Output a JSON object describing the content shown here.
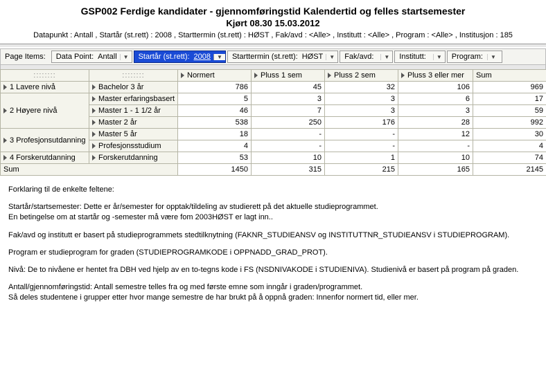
{
  "header": {
    "title": "GSP002 Ferdige kandidater - gjennomføringstid Kalendertid og felles startsemester",
    "run": "Kjørt 08.30 15.03.2012",
    "datapoint": "Datapunkt : Antall , Startår (st.rett) : 2008 , Starttermin (st.rett) : HØST , Fak/avd : <Alle> , Institutt : <Alle> , Program : <Alle> , Institusjon : 185"
  },
  "pageItems": {
    "label": "Page Items:",
    "pills": [
      {
        "label": "Data Point:",
        "value": "Antall",
        "selected": false
      },
      {
        "label": "Startår (st.rett):",
        "value": "2008",
        "selected": true
      },
      {
        "label": "Starttermin (st.rett):",
        "value": "HØST",
        "selected": false
      },
      {
        "label": "Fak/avd:",
        "value": "<Alle>",
        "selected": false
      },
      {
        "label": "Institutt:",
        "value": "<Alle>",
        "selected": false
      },
      {
        "label": "Program:",
        "value": "<A",
        "selected": false
      }
    ]
  },
  "table": {
    "columns": [
      "Normert",
      "Pluss 1 sem",
      "Pluss 2 sem",
      "Pluss 3 eller mer",
      "Sum"
    ],
    "groups": [
      {
        "label": "1 Lavere nivå",
        "rows": [
          {
            "label": "Bachelor 3 år",
            "cells": [
              "786",
              "45",
              "32",
              "106",
              "969"
            ]
          }
        ]
      },
      {
        "label": "2 Høyere nivå",
        "rows": [
          {
            "label": "Master erfaringsbasert",
            "cells": [
              "5",
              "3",
              "3",
              "6",
              "17"
            ]
          },
          {
            "label": "Master 1 - 1 1/2 år",
            "cells": [
              "46",
              "7",
              "3",
              "3",
              "59"
            ]
          },
          {
            "label": "Master 2 år",
            "cells": [
              "538",
              "250",
              "176",
              "28",
              "992"
            ]
          }
        ]
      },
      {
        "label": "3 Profesjonsutdanning",
        "rows": [
          {
            "label": "Master 5 år",
            "cells": [
              "18",
              "-",
              "-",
              "12",
              "30"
            ]
          },
          {
            "label": "Profesjonsstudium",
            "cells": [
              "4",
              "-",
              "-",
              "-",
              "4"
            ]
          }
        ]
      },
      {
        "label": "4 Forskerutdanning",
        "rows": [
          {
            "label": "Forskerutdanning",
            "cells": [
              "53",
              "10",
              "1",
              "10",
              "74"
            ]
          }
        ]
      }
    ],
    "sumLabel": "Sum",
    "sumRow": [
      "1450",
      "315",
      "215",
      "165",
      "2145"
    ]
  },
  "explain": {
    "intro": "Forklaring til de enkelte feltene:",
    "p1a": "Startår/startsemester: Dette er år/semester for opptak/tildeling av studierett på det aktuelle studieprogrammet.",
    "p1b": "En betingelse om at startår og -semester må være fom 2003HØST er lagt inn..",
    "p2": "Fak/avd og institutt er basert på studieprogrammets stedtilknytning (FAKNR_STUDIEANSV og INSTITUTTNR_STUDIEANSV i STUDIEPROGRAM).",
    "p3": "Program er studieprogram for graden (STUDIEPROGRAMKODE i OPPNADD_GRAD_PROT).",
    "p4": "Nivå: De to nivåene er hentet fra DBH ved hjelp av en to-tegns kode i FS (NSDNIVAKODE i STUDIENIVA). Studienivå er basert på program på graden.",
    "p5a": "Antall/gjennomføringstid: Antall semestre telles fra og med første emne som inngår i graden/programmet.",
    "p5b": "Så deles studentene i grupper etter hvor mange semestre de har brukt på å oppnå graden: Innenfor normert tid, eller mer."
  },
  "chart_data": {
    "type": "table",
    "title": "GSP002 Ferdige kandidater - gjennomføringstid",
    "columns": [
      "Normert",
      "Pluss 1 sem",
      "Pluss 2 sem",
      "Pluss 3 eller mer",
      "Sum"
    ],
    "rows": [
      {
        "group": "1 Lavere nivå",
        "sub": "Bachelor 3 år",
        "values": [
          786,
          45,
          32,
          106,
          969
        ]
      },
      {
        "group": "2 Høyere nivå",
        "sub": "Master erfaringsbasert",
        "values": [
          5,
          3,
          3,
          6,
          17
        ]
      },
      {
        "group": "2 Høyere nivå",
        "sub": "Master 1 - 1 1/2 år",
        "values": [
          46,
          7,
          3,
          3,
          59
        ]
      },
      {
        "group": "2 Høyere nivå",
        "sub": "Master 2 år",
        "values": [
          538,
          250,
          176,
          28,
          992
        ]
      },
      {
        "group": "3 Profesjonsutdanning",
        "sub": "Master 5 år",
        "values": [
          18,
          null,
          null,
          12,
          30
        ]
      },
      {
        "group": "3 Profesjonsutdanning",
        "sub": "Profesjonsstudium",
        "values": [
          4,
          null,
          null,
          null,
          4
        ]
      },
      {
        "group": "4 Forskerutdanning",
        "sub": "Forskerutdanning",
        "values": [
          53,
          10,
          1,
          10,
          74
        ]
      }
    ],
    "totals": [
      1450,
      315,
      215,
      165,
      2145
    ]
  }
}
